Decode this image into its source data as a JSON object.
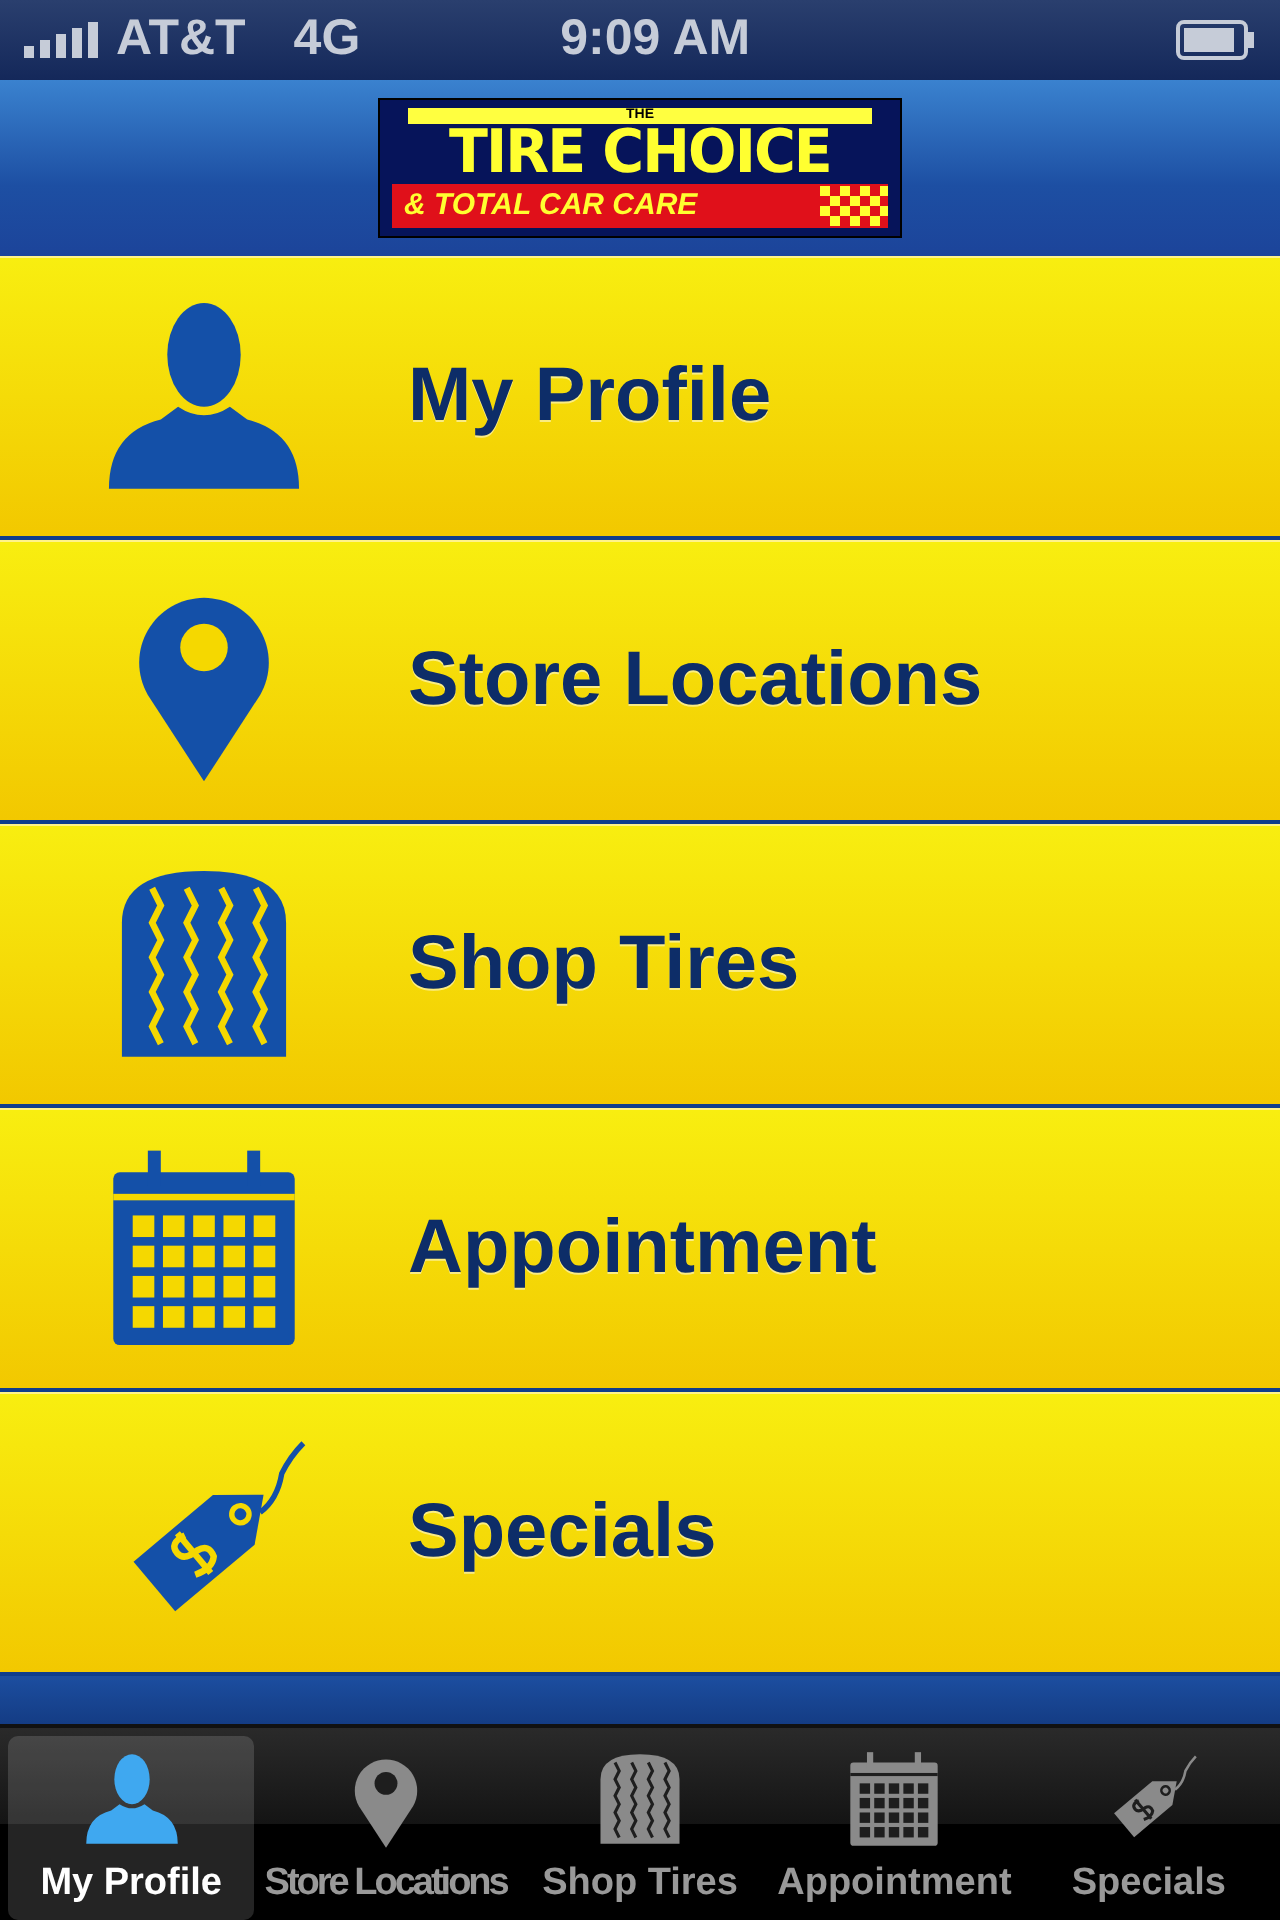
{
  "status_bar": {
    "carrier": "AT&T",
    "network": "4G",
    "time": "9:09 AM"
  },
  "logo": {
    "top": "THE",
    "name": "TIRE CHOICE",
    "tagline": "& TOTAL CAR CARE"
  },
  "menu": [
    {
      "label": "My Profile",
      "kind": "person"
    },
    {
      "label": "Store Locations",
      "kind": "pin"
    },
    {
      "label": "Shop Tires",
      "kind": "tire"
    },
    {
      "label": "Appointment",
      "kind": "calendar"
    },
    {
      "label": "Specials",
      "kind": "tag"
    }
  ],
  "tabs": [
    {
      "label": "My Profile",
      "kind": "person",
      "selected": true
    },
    {
      "label": "Store Locations",
      "kind": "pin",
      "selected": false
    },
    {
      "label": "Shop Tires",
      "kind": "tire",
      "selected": false
    },
    {
      "label": "Appointment",
      "kind": "calendar",
      "selected": false
    },
    {
      "label": "Specials",
      "kind": "tag",
      "selected": false
    }
  ]
}
